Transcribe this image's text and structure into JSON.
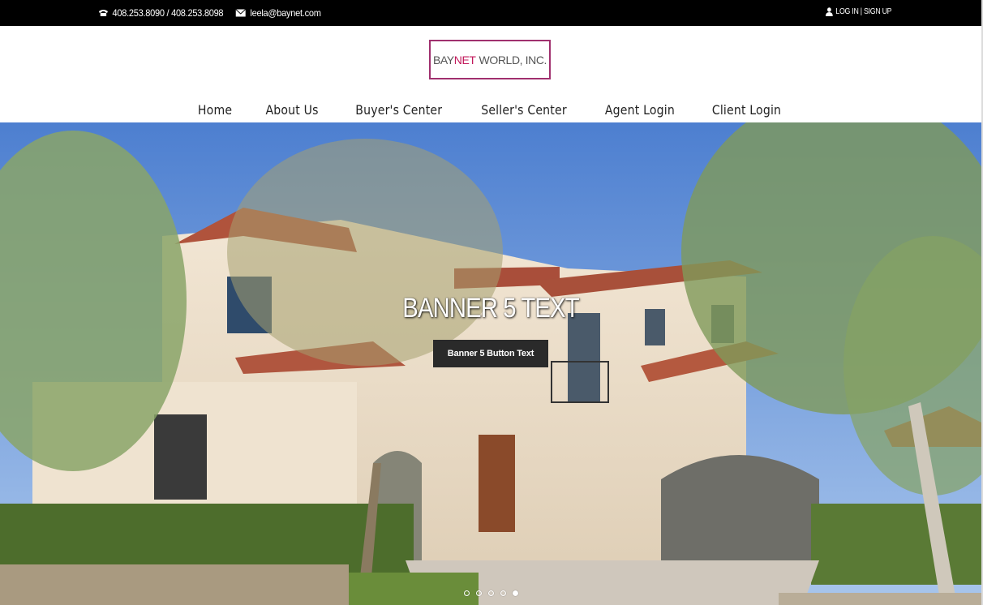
{
  "topbar": {
    "phone": "408.253.8090 / 408.253.8098",
    "email": "leela@baynet.com",
    "auth": "LOG IN | SIGN UP"
  },
  "logo": {
    "bay": "BAY",
    "net": "NET",
    "world": "WORLD, INC."
  },
  "nav": {
    "items": [
      {
        "label": "Home"
      },
      {
        "label": "About Us"
      },
      {
        "label": "Buyer's Center"
      },
      {
        "label": "Seller's Center"
      },
      {
        "label": "Agent Login"
      },
      {
        "label": "Client Login"
      }
    ]
  },
  "hero": {
    "title": "BANNER 5 TEXT",
    "button": "Banner 5 Button Text",
    "slides": 5,
    "active_slide": 5
  },
  "colors": {
    "accent": "#a0306e",
    "net": "#c2185b",
    "topbar": "#000000",
    "button": "#2a2a2a"
  },
  "icons": {
    "phone": "phone-icon",
    "mail": "mail-icon",
    "user": "user-icon"
  }
}
